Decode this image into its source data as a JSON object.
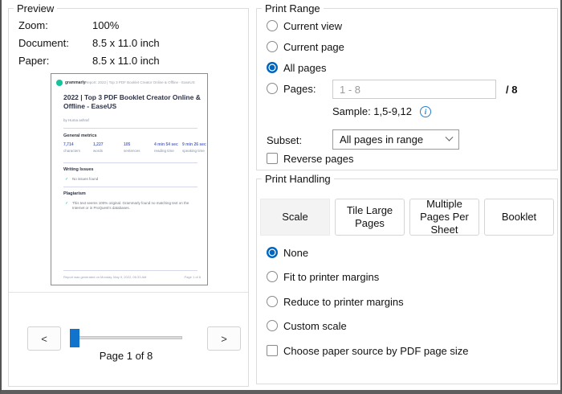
{
  "colors": {
    "accent_blue": "#0067c0",
    "slider_blue": "#1173cc",
    "info_blue": "#2a7fc9",
    "grammarly_green": "#15c39a",
    "metric_blue": "#5d6cc9",
    "check_green": "#19b394"
  },
  "preview": {
    "group_label": "Preview",
    "fields": [
      {
        "label": "Zoom:",
        "value": "100%"
      },
      {
        "label": "Document:",
        "value": "8.5 x 11.0 inch"
      },
      {
        "label": "Paper:",
        "value": "8.5 x 11.0 inch"
      }
    ],
    "thumbnail": {
      "brand": "grammarly",
      "header_text": "Report: 2022 | Top 3 PDF Booklet Creator Online & Offline - EaseUS",
      "title": "2022 | Top 3 PDF Booklet Creator Online & Offline - EaseUS",
      "byline": "by Huma ashraf",
      "metrics_heading": "General metrics",
      "metrics": [
        {
          "value": "7,714",
          "label": "characters"
        },
        {
          "value": "1,227",
          "label": "words"
        },
        {
          "value": "105",
          "label": "sentences"
        },
        {
          "value": "4 min 54 sec",
          "label": "reading time"
        },
        {
          "value": "9 min 26 sec",
          "label": "speaking time"
        }
      ],
      "writing_issues_heading": "Writing Issues",
      "writing_issues_check": "✓",
      "writing_issues_item": "No issues found",
      "plagiarism_heading": "Plagiarism",
      "plagiarism_check": "✓",
      "plagiarism_item": "This text seems 100% original. Grammarly found no matching text on the Internet or in ProQuest's databases.",
      "footer_left": "Report was generated on Monday, May 9, 2022, 06:33 AM",
      "footer_right": "Page 1 of 8"
    },
    "nav": {
      "prev_label": "<",
      "next_label": ">",
      "page_status": "Page 1 of 8"
    }
  },
  "print_range": {
    "group_label": "Print Range",
    "options": [
      {
        "label": "Current view",
        "selected": false
      },
      {
        "label": "Current page",
        "selected": false
      },
      {
        "label": "All pages",
        "selected": true
      },
      {
        "label": "Pages:",
        "selected": false
      }
    ],
    "pages_value": "1 - 8",
    "pages_suffix": "/ 8",
    "sample_text": "Sample: 1,5-9,12",
    "info_icon_glyph": "i",
    "subset_label": "Subset:",
    "subset_value": "All pages in range",
    "reverse_pages_label": "Reverse pages",
    "reverse_pages_checked": false
  },
  "print_handling": {
    "group_label": "Print Handling",
    "tabs": [
      {
        "label": "Scale",
        "selected": true
      },
      {
        "label": "Tile Large Pages",
        "selected": false
      },
      {
        "label": "Multiple Pages Per Sheet",
        "selected": false
      },
      {
        "label": "Booklet",
        "selected": false
      }
    ],
    "scale_options": [
      {
        "label": "None",
        "selected": true
      },
      {
        "label": "Fit to printer margins",
        "selected": false
      },
      {
        "label": "Reduce to printer margins",
        "selected": false
      },
      {
        "label": "Custom scale",
        "selected": false
      }
    ],
    "paper_source_label": "Choose paper source by PDF page size",
    "paper_source_checked": false
  }
}
